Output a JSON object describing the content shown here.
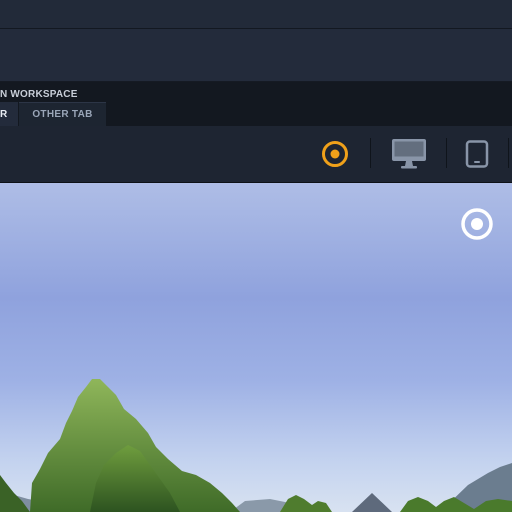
{
  "workspace": {
    "title": "N WORKSPACE",
    "tabs": [
      {
        "label": "R",
        "active": true
      },
      {
        "label": "OTHER TAB",
        "active": false
      }
    ]
  },
  "toolbar": {
    "buttons": [
      {
        "icon": "target-icon",
        "color": "#f0a11a",
        "active": true
      },
      {
        "icon": "desktop-icon",
        "color": "#8995a8",
        "active": false
      },
      {
        "icon": "tablet-icon",
        "color": "#8995a8",
        "active": false
      }
    ]
  },
  "viewport": {
    "image": "panorama-sky-trees-mountain",
    "overlay_icon": "target-icon",
    "overlay_color": "#ffffff"
  },
  "colors": {
    "accent": "#f0a11a",
    "toolbar_bg": "#1e2532",
    "header_bg": "#131820"
  }
}
